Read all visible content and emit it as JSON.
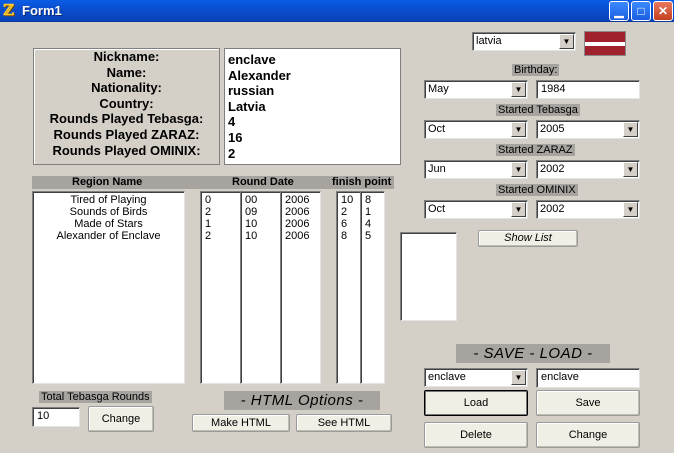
{
  "window": {
    "title": "Form1"
  },
  "profile": {
    "labels": [
      "Nickname:",
      "Name:",
      "Nationality:",
      "Country:",
      "Rounds Played Tebasga:",
      "Rounds Played ZARAZ:",
      "Rounds Played OMINIX:"
    ],
    "values": [
      "enclave",
      "Alexander",
      "russian",
      "Latvia",
      "4",
      "16",
      "2"
    ]
  },
  "country_select": {
    "value": "latvia"
  },
  "flag_colors": {
    "band": "#a0202e",
    "stripe": "#ffffff"
  },
  "birthday": {
    "label": "Birthday:",
    "month": "May",
    "year": "1984"
  },
  "started_tebasga": {
    "label": "Started Tebasga",
    "month": "Oct",
    "year": "2005"
  },
  "started_zaraz": {
    "label": "Started ZARAZ",
    "month": "Jun",
    "year": "2002"
  },
  "started_ominix": {
    "label": "Started OMINIX",
    "month": "Oct",
    "year": "2002"
  },
  "show_list_label": "Show List",
  "table": {
    "headers": {
      "region": "Region Name",
      "date": "Round Date",
      "finish": "finish point"
    },
    "regions": [
      "Tired of Playing",
      "Sounds of Birds",
      "Made of Stars",
      "Alexander of Enclave"
    ],
    "date_col1": [
      "0",
      "2",
      "1",
      "2"
    ],
    "date_col2": [
      "00",
      "09",
      "10",
      "10"
    ],
    "date_col3": [
      "2006",
      "2006",
      "2006",
      "2006"
    ],
    "finish_col1": [
      "10",
      "2",
      "6",
      "8"
    ],
    "finish_col2": [
      "8",
      "1",
      "4",
      "5"
    ]
  },
  "total_rounds": {
    "label": "Total Tebasga Rounds",
    "value": "10",
    "change_label": "Change"
  },
  "html_options": {
    "title": "- HTML Options -",
    "make_label": "Make HTML",
    "see_label": "See HTML"
  },
  "save_load": {
    "title": "- SAVE - LOAD -",
    "select_value": "enclave",
    "name_value": "enclave",
    "load_label": "Load",
    "save_label": "Save",
    "delete_label": "Delete",
    "change_label": "Change"
  }
}
